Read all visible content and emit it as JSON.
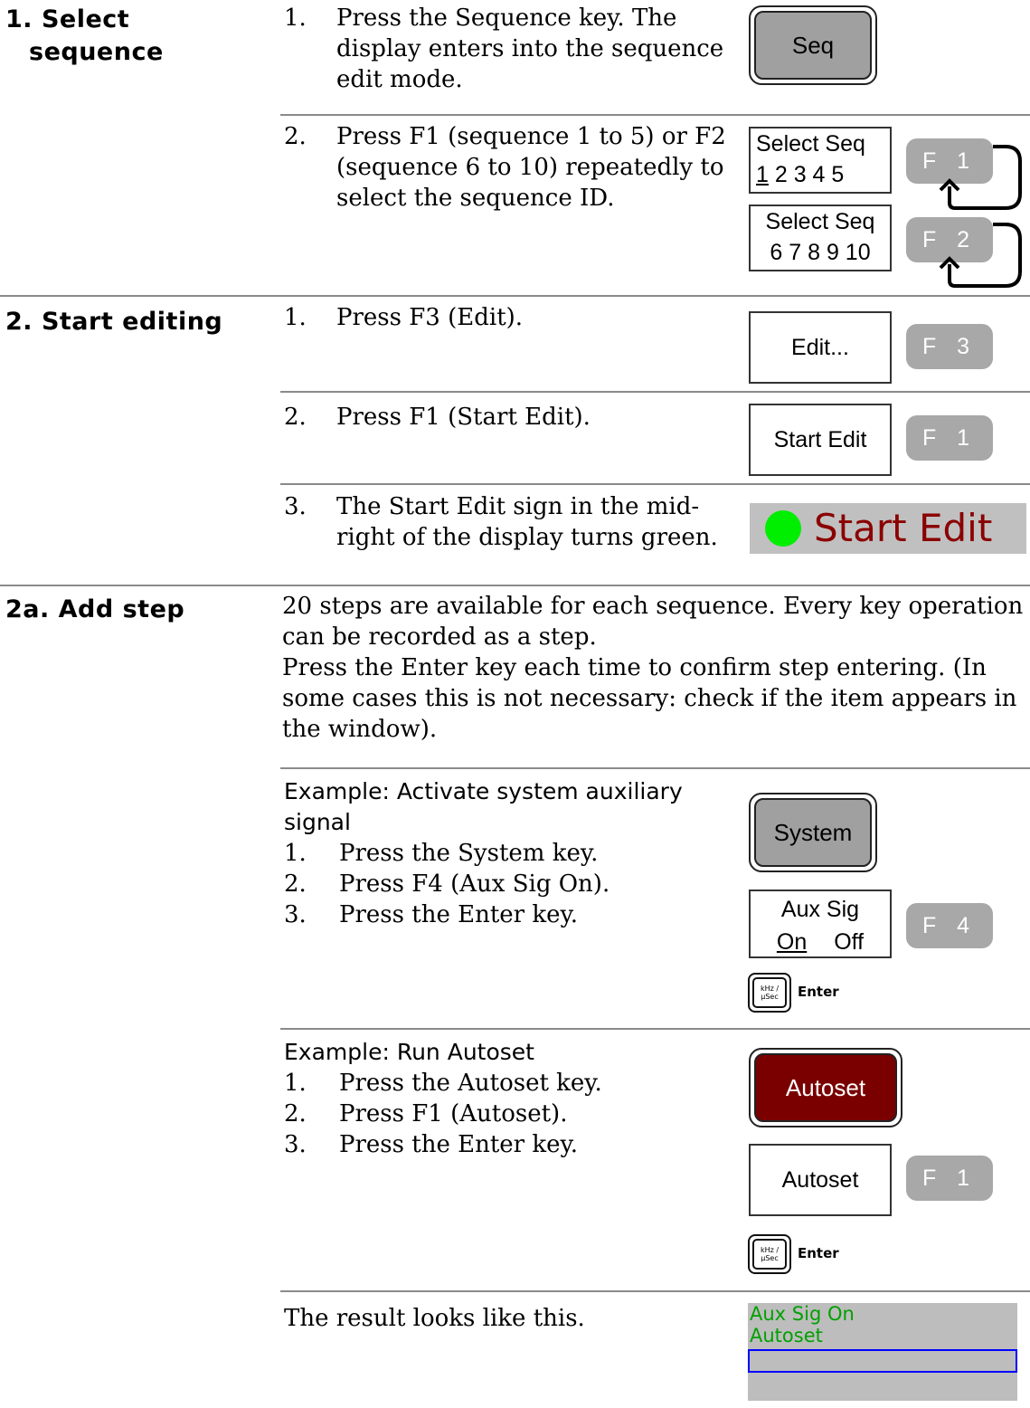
{
  "sections": {
    "select_sequence": {
      "heading": "1. Select sequence",
      "heading_line1": "1. Select",
      "heading_line2": "sequence",
      "step1_num": "1.",
      "step1_text": "Press the Sequence key. The display enters into the sequence edit mode.",
      "seq_key_label": "Seq",
      "step2_num": "2.",
      "step2_text": "Press F1 (sequence 1 to 5) or F2 (sequence 6 to 10) repeatedly to select the sequence ID.",
      "softkey1_title": "Select Seq",
      "softkey1_first": "1",
      "softkey1_rest": " 2 3 4 5",
      "softkey2_title": "Select Seq",
      "softkey2_values": "6 7 8 9 10",
      "f1_label": "F 1",
      "f2_label": "F 2"
    },
    "start_editing": {
      "heading": "2. Start editing",
      "step1_num": "1.",
      "step1_text": "Press F3 (Edit).",
      "edit_softkey": "Edit...",
      "f3_label": "F 3",
      "step2_num": "2.",
      "step2_text": "Press F1 (Start Edit).",
      "start_edit_softkey": "Start Edit",
      "f1_label": "F 1",
      "step3_num": "3.",
      "step3_text": "The Start Edit sign in the mid-right of the display turns green.",
      "indicator_label": "Start Edit",
      "indicator_color": "#00ee00"
    },
    "add_step": {
      "heading": "2a. Add step",
      "para1": "20 steps are available for each sequence. Every key operation can be recorded as a step.",
      "para2": "Press the Enter key each time to confirm step entering. (In some cases this is not necessary: check if the item appears in the window).",
      "example1": {
        "title": "Example: Activate system auxiliary signal",
        "steps": [
          {
            "num": "1.",
            "text": "Press the System key."
          },
          {
            "num": "2.",
            "text": "Press F4 (Aux Sig On)."
          },
          {
            "num": "3.",
            "text": "Press the Enter key."
          }
        ],
        "system_key": "System",
        "softkey_title": "Aux Sig",
        "softkey_on": "On",
        "softkey_off": "Off",
        "f4_label": "F 4",
        "enter_key_line1": "kHz /",
        "enter_key_line2": "µSec",
        "enter_label": "Enter"
      },
      "example2": {
        "title": "Example: Run Autoset",
        "steps": [
          {
            "num": "1.",
            "text": "Press the Autoset key."
          },
          {
            "num": "2.",
            "text": "Press F1 (Autoset)."
          },
          {
            "num": "3.",
            "text": "Press the Enter key."
          }
        ],
        "autoset_key": "Autoset",
        "autoset_key_color": "#7a0000",
        "softkey": "Autoset",
        "f1_label": "F 1",
        "enter_key_line1": "kHz /",
        "enter_key_line2": "µSec",
        "enter_label": "Enter"
      },
      "result_text": "The result looks like this.",
      "result_display": {
        "line1": "Aux Sig On",
        "line2": "Autoset",
        "text_color": "#00a000"
      }
    }
  }
}
